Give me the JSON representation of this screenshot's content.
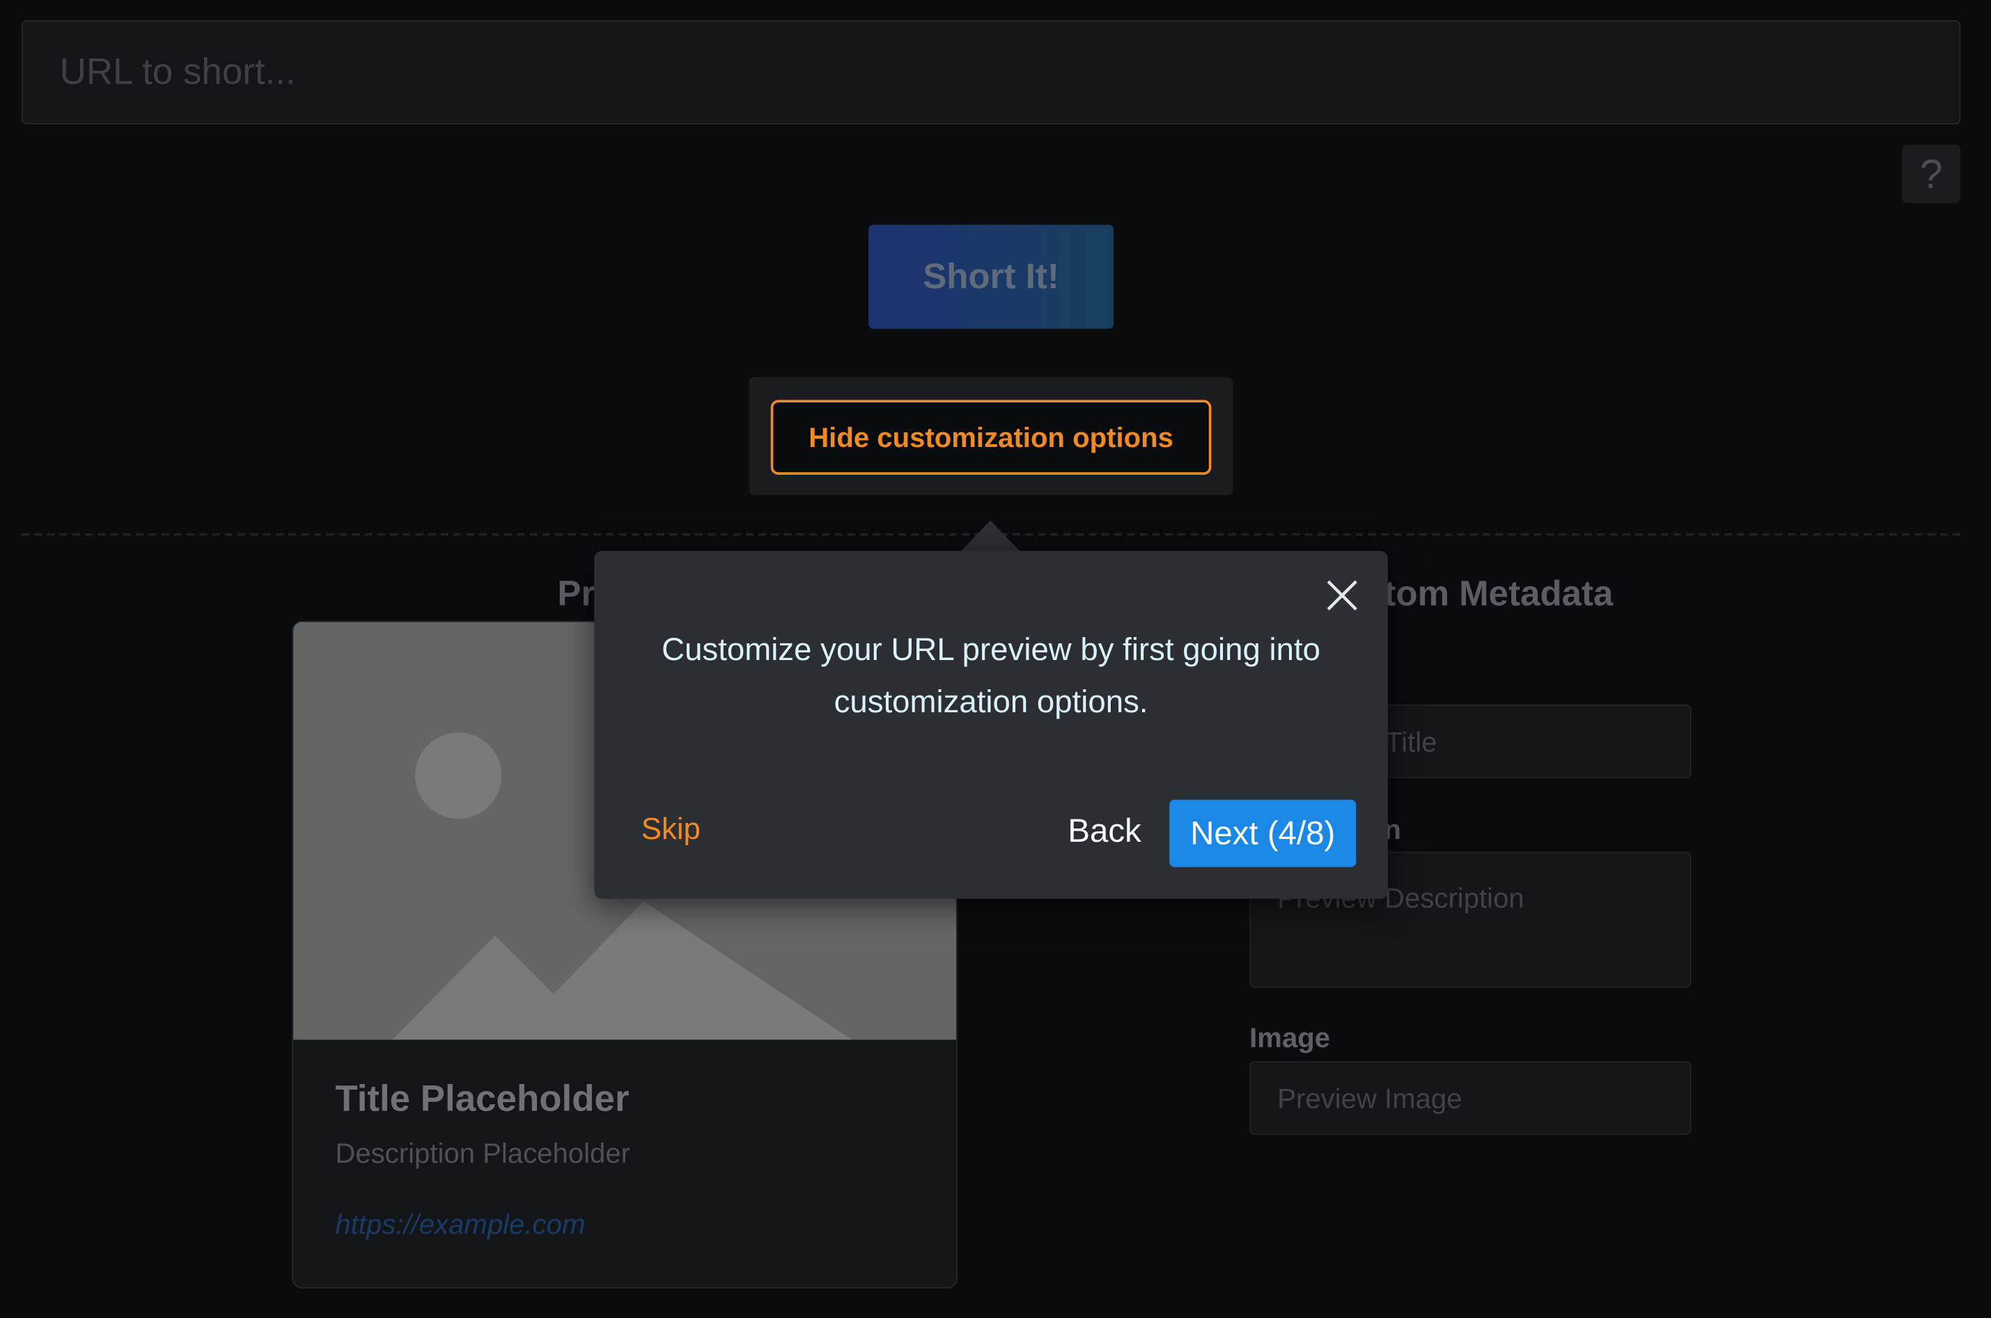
{
  "url_input": {
    "placeholder": "URL to short..."
  },
  "help_button": {
    "label": "?"
  },
  "short_button": {
    "label": "Short It!"
  },
  "toggle_customization": {
    "label": "Hide customization options"
  },
  "preview_section": {
    "heading_visible": "Pr"
  },
  "metadata_section": {
    "heading_visible": "tom Metadata"
  },
  "preview_card": {
    "title": "Title Placeholder",
    "description": "Description Placeholder",
    "url": "https://example.com"
  },
  "metadata_form": {
    "title_placeholder_visible": "Title",
    "description_label_visible": "n",
    "description_placeholder": "Preview Description",
    "image_label": "Image",
    "image_placeholder": "Preview Image"
  },
  "tour_popover": {
    "message": "Customize your URL preview by first going into customization options.",
    "skip_label": "Skip",
    "back_label": "Back",
    "next_label": "Next (4/8)",
    "step_current": 4,
    "step_total": 8
  },
  "colors": {
    "background": "#0a0b0d",
    "accent_orange": "#f08a24",
    "next_button_blue": "#1c88e5",
    "popover_bg": "#2c2e33",
    "popover_text": "#d9f2fb",
    "link_blue": "#1a3a66"
  },
  "icons": {
    "close": "close-icon",
    "image_placeholder": "image-placeholder-icon"
  }
}
